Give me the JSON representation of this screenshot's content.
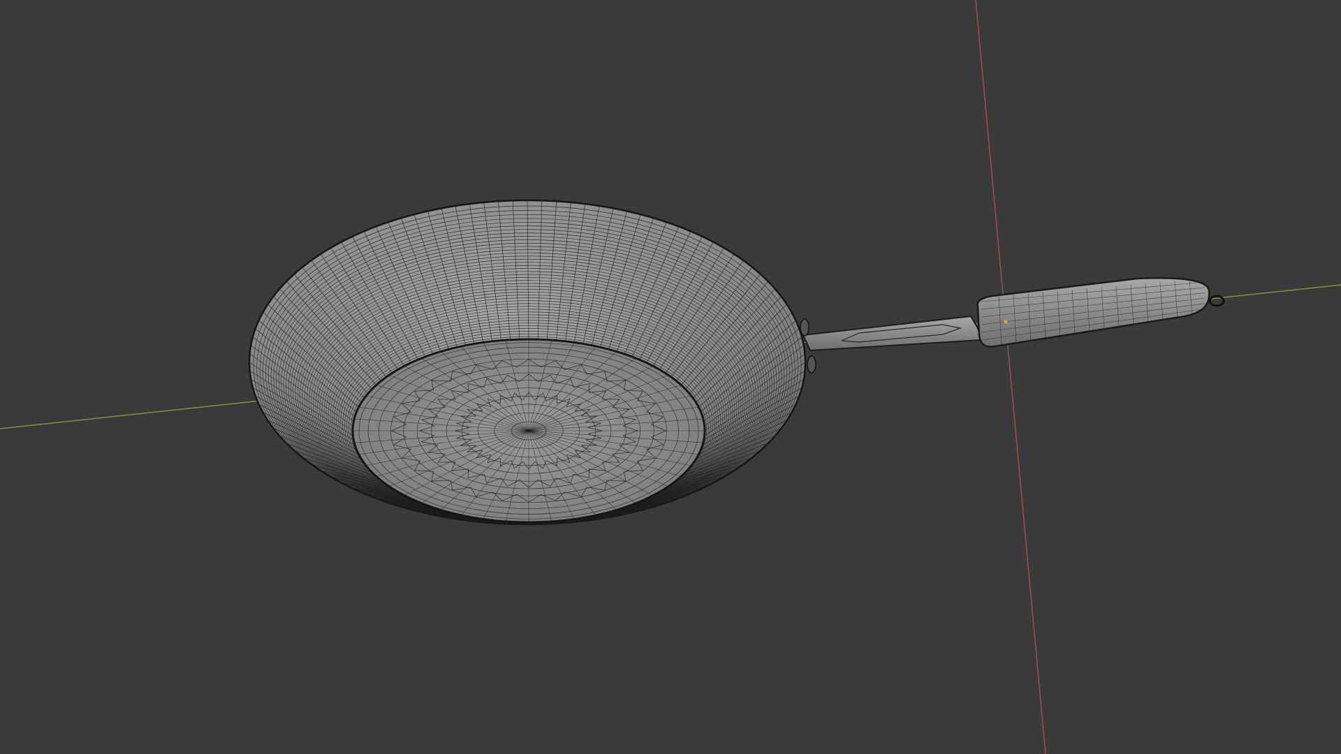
{
  "viewport": {
    "background_color": "#3a3a3a",
    "shading": "solid-with-wireframe",
    "object": "frying-pan"
  },
  "axes": {
    "x_axis_color": "#a85050",
    "y_axis_color": "#7a9a3a"
  },
  "mesh": {
    "surface_color": "#8c8c8c",
    "wire_color": "#1c1c1c"
  },
  "origin_marker_color": "#f0a020"
}
